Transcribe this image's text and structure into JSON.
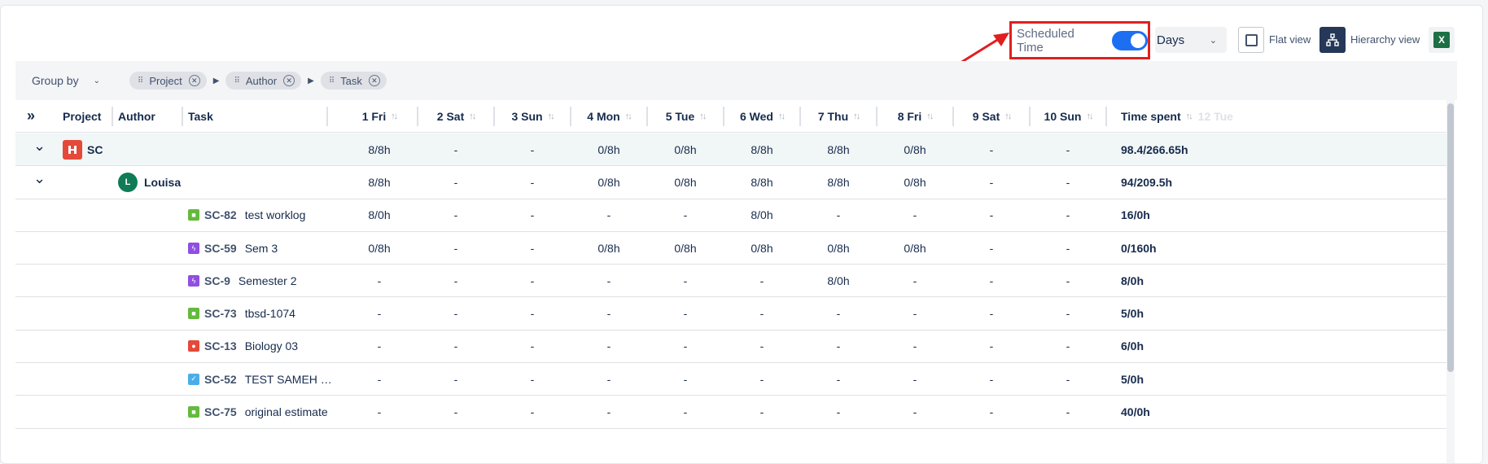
{
  "toolbar": {
    "scheduled_time_label": "Scheduled Time",
    "scheduled_time_on": true,
    "period_select": "Days",
    "flat_view_label": "Flat view",
    "hierarchy_view_label": "Hierarchy view",
    "excel_icon": "X"
  },
  "groupbar": {
    "group_by_label": "Group by",
    "chips": [
      "Project",
      "Author",
      "Task"
    ]
  },
  "columns": {
    "project": "Project",
    "author": "Author",
    "task": "Task",
    "days": [
      "1 Fri",
      "2 Sat",
      "3 Sun",
      "4 Mon",
      "5 Tue",
      "6 Wed",
      "7 Thu",
      "8 Fri",
      "9 Sat",
      "10 Sun"
    ],
    "time_spent": "Time spent",
    "overflow_faded": "12 Tue"
  },
  "rows": [
    {
      "level": "project",
      "name": "SC",
      "days": [
        "8/8h",
        "-",
        "-",
        "0/8h",
        "0/8h",
        "8/8h",
        "8/8h",
        "0/8h",
        "-",
        "-"
      ],
      "spent": "98.4/266.65h"
    },
    {
      "level": "author",
      "avatar": "L",
      "name": "Louisa",
      "days": [
        "8/8h",
        "-",
        "-",
        "0/8h",
        "0/8h",
        "8/8h",
        "8/8h",
        "0/8h",
        "-",
        "-"
      ],
      "spent": "94/209.5h"
    },
    {
      "level": "task",
      "key": "SC-82",
      "name": "test worklog",
      "icon": "story",
      "days": [
        "8/0h",
        "-",
        "-",
        "-",
        "-",
        "8/0h",
        "-",
        "-",
        "-",
        "-"
      ],
      "spent": "16/0h"
    },
    {
      "level": "task",
      "key": "SC-59",
      "name": "Sem 3",
      "icon": "epic",
      "days": [
        "0/8h",
        "-",
        "-",
        "0/8h",
        "0/8h",
        "0/8h",
        "0/8h",
        "0/8h",
        "-",
        "-"
      ],
      "spent": "0/160h"
    },
    {
      "level": "task",
      "key": "SC-9",
      "name": "Semester 2",
      "icon": "epic",
      "days": [
        "-",
        "-",
        "-",
        "-",
        "-",
        "-",
        "8/0h",
        "-",
        "-",
        "-"
      ],
      "spent": "8/0h"
    },
    {
      "level": "task",
      "key": "SC-73",
      "name": "tbsd-1074",
      "icon": "story",
      "days": [
        "-",
        "-",
        "-",
        "-",
        "-",
        "-",
        "-",
        "-",
        "-",
        "-"
      ],
      "spent": "5/0h"
    },
    {
      "level": "task",
      "key": "SC-13",
      "name": "Biology 03",
      "icon": "bug",
      "days": [
        "-",
        "-",
        "-",
        "-",
        "-",
        "-",
        "-",
        "-",
        "-",
        "-"
      ],
      "spent": "6/0h"
    },
    {
      "level": "task",
      "key": "SC-52",
      "name": "TEST SAMEH …",
      "icon": "task",
      "days": [
        "-",
        "-",
        "-",
        "-",
        "-",
        "-",
        "-",
        "-",
        "-",
        "-"
      ],
      "spent": "5/0h"
    },
    {
      "level": "task",
      "key": "SC-75",
      "name": "original estimate",
      "icon": "story",
      "days": [
        "-",
        "-",
        "-",
        "-",
        "-",
        "-",
        "-",
        "-",
        "-",
        "-"
      ],
      "spent": "40/0h"
    }
  ],
  "colors": {
    "story": "#63ba3c",
    "epic": "#904ee2",
    "bug": "#e5493a",
    "task": "#4bade8",
    "toggle": "#1d6ff2",
    "highlight": "#e01f1f"
  }
}
